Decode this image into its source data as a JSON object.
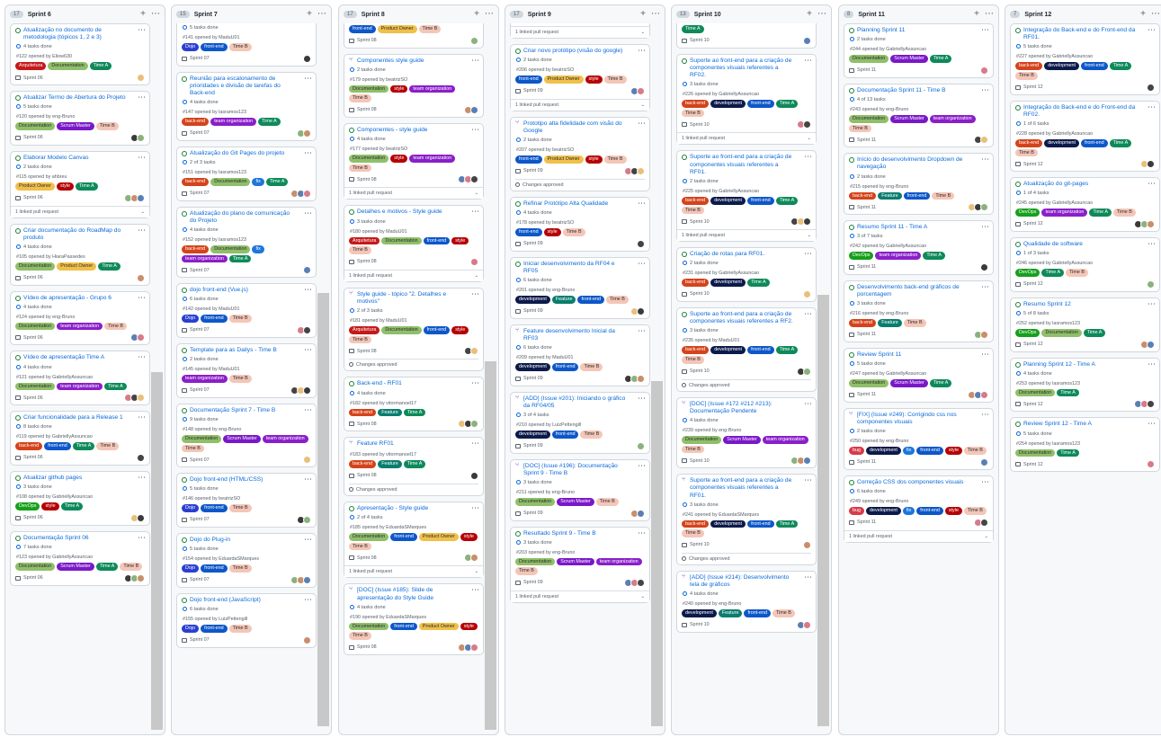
{
  "columns": [
    {
      "title": "Sprint 6",
      "count": "17",
      "cards": [
        {
          "t": "Atualização no documento de metodologia (tópicos 1, 2 e 3)",
          "p": "4 tasks done",
          "m": "#122 opened by Eliow630",
          "l": [
            "Arquitetura",
            "Documentation",
            "Time A"
          ],
          "s": "Sprint 06"
        },
        {
          "t": "Atualizar Termo de Abertura do Projeto",
          "p": "5 tasks done",
          "m": "#120 opened by eng-Bruno",
          "l": [
            "Documentation",
            "Scrum Master",
            "Time B"
          ],
          "s": "Sprint 06"
        },
        {
          "t": "Elaborar Modelo Canvas",
          "p": "2 tasks done",
          "m": "#115 opened by ahbreu",
          "l": [
            "Product Owner",
            "style",
            "Time A"
          ],
          "s": "Sprint 06",
          "pr": "1 linked pull request"
        },
        {
          "t": "Criar documentação do RoadMap do produto",
          "p": "4 tasks done",
          "m": "#105 opened by HiaraPassedes",
          "l": [
            "Documentation",
            "Product Owner",
            "Time A"
          ],
          "s": "Sprint 06"
        },
        {
          "t": "Vídeo de apresentação - Grupo 6",
          "p": "4 tasks done",
          "m": "#124 opened by eng-Bruno",
          "l": [
            "Documentation",
            "team organization",
            "Time B"
          ],
          "s": "Sprint 06"
        },
        {
          "t": "Vídeo de apresentação Time A",
          "p": "4 tasks done",
          "m": "#121 opened by GabriellyAssuncao",
          "l": [
            "Documentation",
            "team organization",
            "Time A"
          ],
          "s": "Sprint 06"
        },
        {
          "t": "Criar funcionalidade para a Release 1",
          "p": "8 tasks done",
          "m": "#119 opened by GabriellyAssuncao",
          "l": [
            "back-end",
            "front-end",
            "Time A",
            "Time B"
          ],
          "s": "Sprint 06"
        },
        {
          "t": "Atualizar github pages",
          "p": "3 tasks done",
          "m": "#108 opened by GabriellyAssuncao",
          "l": [
            "DevOps",
            "style",
            "Time A"
          ],
          "s": "Sprint 06"
        },
        {
          "t": "Documentação Sprint 06",
          "p": "7 tasks done",
          "m": "#123 opened by GabriellyAssuncao",
          "l": [
            "Documentation",
            "Scrum Master",
            "Time A",
            "Time B"
          ],
          "s": "Sprint 06"
        }
      ]
    },
    {
      "title": "Sprint 7",
      "count": "15",
      "cards": [
        {
          "t": "",
          "p": "5 tasks done",
          "m": "#141 opened by MaduU01",
          "l": [
            "Dojo",
            "front-end",
            "Time B"
          ],
          "s": "Sprint 07",
          "cut": true
        },
        {
          "t": "Reunião para escalonamento de prioridades e divisão de tarefas do Back-end",
          "p": "4 tasks done",
          "m": "#147 opened by lasramos123",
          "l": [
            "back-end",
            "team organization",
            "Time A"
          ],
          "s": "Sprint 07"
        },
        {
          "t": "Atualização do Git Pages do projeto",
          "p": "2 of 3 tasks",
          "m": "#151 opened by lasramos123",
          "l": [
            "back-end",
            "Documentation",
            "fix",
            "Time A"
          ],
          "s": "Sprint 07"
        },
        {
          "t": "Atualização do plano de comunicação do Projeto",
          "p": "4 tasks done",
          "m": "#152 opened by lasramos123",
          "l": [
            "back-end",
            "Documentation",
            "fix",
            "team organization",
            "Time A"
          ],
          "s": "Sprint 07"
        },
        {
          "t": "dojo front-end (Vue.js)",
          "p": "6 tasks done",
          "m": "#142 opened by MaduU01",
          "l": [
            "Dojo",
            "front-end",
            "Time B"
          ],
          "s": "Sprint 07"
        },
        {
          "t": "Template para as Dailys - Time B",
          "p": "2 tasks done",
          "m": "#145 opened by MaduU01",
          "l": [
            "team organization",
            "Time B"
          ],
          "s": "Sprint 07"
        },
        {
          "t": "Documentação Sprint 7 - Time B",
          "p": "9 tasks done",
          "m": "#148 opened by eng-Bruno",
          "l": [
            "Documentation",
            "Scrum Master",
            "team organization",
            "Time B"
          ],
          "s": "Sprint 07"
        },
        {
          "t": "Dojo front-end (HTML/CSS)",
          "p": "5 tasks done",
          "m": "#146 opened by beatrizSO",
          "l": [
            "Dojo",
            "front-end",
            "Time B"
          ],
          "s": "Sprint 07"
        },
        {
          "t": "Dojo do Plug-in",
          "p": "5 tasks done",
          "m": "#154 opened by EduardaSMarques",
          "l": [
            "Dojo",
            "front-end",
            "Time B"
          ],
          "s": "Sprint 07"
        },
        {
          "t": "Dojo front-end (JavaScript)",
          "p": "6 tasks done",
          "m": "#155 opened by LuizPettengill",
          "l": [
            "Dojo",
            "front-end",
            "Time B"
          ],
          "s": "Sprint 07"
        }
      ]
    },
    {
      "title": "Sprint 8",
      "count": "17",
      "cards": [
        {
          "t": "",
          "p": "",
          "m": "",
          "l": [
            "front-end",
            "Product Owner",
            "Time B"
          ],
          "s": "Sprint 08",
          "cut": true
        },
        {
          "t": "Componentes style guide",
          "p": "2 tasks done",
          "m": "#179 opened by beatrizSO",
          "l": [
            "Documentation",
            "style",
            "team organization",
            "Time B"
          ],
          "s": "Sprint 08",
          "isPr": true
        },
        {
          "t": "Componentes - style guide",
          "p": "4 tasks done",
          "m": "#177 opened by beatrizSO",
          "l": [
            "Documentation",
            "style",
            "team organization",
            "Time B"
          ],
          "s": "Sprint 08",
          "pr": "1 linked pull request"
        },
        {
          "t": "Detalhes e motivos - Style guide",
          "p": "3 tasks done",
          "m": "#180 opened by MaduU01",
          "l": [
            "Arquitetura",
            "Documentation",
            "front-end",
            "style",
            "Time B"
          ],
          "s": "Sprint 08",
          "pr": "1 linked pull request"
        },
        {
          "t": "Style guide - tópico \"2. Detalhes e motivos\"",
          "p": "2 of 3 tasks",
          "m": "#181 opened by MaduU01",
          "l": [
            "Arquitetura",
            "Documentation",
            "front-end",
            "style",
            "Time B"
          ],
          "s": "Sprint 08",
          "isPr": true,
          "ap": "Changes approved"
        },
        {
          "t": "Back-end - RF01",
          "p": "4 tasks done",
          "m": "#182 opened by vitormanoel17",
          "l": [
            "back-end",
            "Feature",
            "Time A"
          ],
          "s": "Sprint 08"
        },
        {
          "t": "Feature RF01",
          "p": "",
          "m": "#183 opened by vitormanoel17",
          "l": [
            "back-end",
            "Feature",
            "Time A"
          ],
          "s": "Sprint 08",
          "isPr": true,
          "ap": "Changes approved"
        },
        {
          "t": "Apresentação - Style guide",
          "p": "2 of 4 tasks",
          "m": "#185 opened by EduardaSMarques",
          "l": [
            "Documentation",
            "front-end",
            "Product Owner",
            "style",
            "Time B"
          ],
          "s": "Sprint 08",
          "pr": "1 linked pull request"
        },
        {
          "t": "[DOC] (Issue #185): Slide de apresentação do Style Guide",
          "p": "4 tasks done",
          "m": "#190 opened by EduardaSMarques",
          "l": [
            "Documentation",
            "front-end",
            "Product Owner",
            "style",
            "Time B"
          ],
          "s": "Sprint 08",
          "isPr": true
        }
      ]
    },
    {
      "title": "Sprint 9",
      "count": "17",
      "cards": [
        {
          "t": "",
          "p": "",
          "m": "",
          "l": [],
          "s": "",
          "cut": true,
          "pr": "1 linked pull request"
        },
        {
          "t": "Criar novo protótipo (visão do google)",
          "p": "2 tasks done",
          "m": "#206 opened by beatrizSO",
          "l": [
            "front-end",
            "Product Owner",
            "style",
            "Time B"
          ],
          "s": "Sprint 09",
          "pr": "1 linked pull request"
        },
        {
          "t": "Prototipo alta fidelidade com visão do Google",
          "p": "2 tasks done",
          "m": "#207 opened by beatrizSO",
          "l": [
            "front-end",
            "Product Owner",
            "style",
            "Time B"
          ],
          "s": "Sprint 09",
          "isPr": true,
          "ap": "Changes approved"
        },
        {
          "t": "Refinar Protótipo Alta Qualidade",
          "p": "4 tasks done",
          "m": "#178 opened by beatrizSO",
          "l": [
            "front-end",
            "style",
            "Time B"
          ],
          "s": "Sprint 09"
        },
        {
          "t": "Iniciar desenvolvimento da RF04 e RF05",
          "p": "6 tasks done",
          "m": "#201 opened by eng-Bruno",
          "l": [
            "development",
            "Feature",
            "front-end",
            "Time B"
          ],
          "s": "Sprint 09"
        },
        {
          "t": "Feature desenvolvimento Inicial da RF03",
          "p": "6 tasks done",
          "m": "#209 opened by MaduU01",
          "l": [
            "development",
            "front-end",
            "Time B"
          ],
          "s": "Sprint 09",
          "isPr": true
        },
        {
          "t": "[ADD] (Issue #201): Iniciando o gráfico da RF04/05",
          "p": "3 of 4 tasks",
          "m": "#210 opened by LuizPettengill",
          "l": [
            "development",
            "front-end",
            "Time B"
          ],
          "s": "Sprint 09",
          "isPr": true
        },
        {
          "t": "[DOC] (Issue #196): Documentação Sprint 9 - Time B",
          "p": "3 tasks done",
          "m": "#211 opened by eng-Bruno",
          "l": [
            "Documentation",
            "Scrum Master",
            "Time B"
          ],
          "s": "Sprint 09",
          "isPr": true
        },
        {
          "t": "Resultado Sprint 9 - Time B",
          "p": "3 tasks done",
          "m": "#203 opened by eng-Bruno",
          "l": [
            "Documentation",
            "Scrum Master",
            "team organization",
            "Time B"
          ],
          "s": "Sprint 09",
          "pr": "1 linked pull request"
        }
      ]
    },
    {
      "title": "Sprint 10",
      "count": "13",
      "cards": [
        {
          "t": "",
          "p": "",
          "m": "",
          "l": [
            "Time A"
          ],
          "s": "Sprint 10",
          "cut": true
        },
        {
          "t": "Suporte ao front-end para a criação de componentes visuais referentes a RF02.",
          "p": "3 tasks done",
          "m": "#226 opened by GabriellyAssuncao",
          "l": [
            "back-end",
            "development",
            "front-end",
            "Time A",
            "Time B"
          ],
          "s": "Sprint 10",
          "pr": "1 linked pull request"
        },
        {
          "t": "Suporte ao front-end para a criação de componentes visuais referentes a RF01.",
          "p": "2 tasks done",
          "m": "#225 opened by GabriellyAssuncao",
          "l": [
            "back-end",
            "development",
            "front-end",
            "Time A",
            "Time B"
          ],
          "s": "Sprint 10",
          "pr": "1 linked pull request"
        },
        {
          "t": "Criação de rotas para RF01.",
          "p": "2 tasks done",
          "m": "#231 opened by GabriellyAssuncao",
          "l": [
            "back-end",
            "development",
            "Time A"
          ],
          "s": "Sprint 10"
        },
        {
          "t": "Suporte ao front-end para a criação de componentes visuais referentes a RF2.",
          "p": "3 tasks done",
          "m": "#235 opened by MaduU01",
          "l": [
            "back-end",
            "development",
            "front-end",
            "Time A",
            "Time B"
          ],
          "s": "Sprint 10",
          "ap": "Changes approved"
        },
        {
          "t": "[DOC] (Issue #172 #212 #213): Documentação Pendente",
          "p": "4 tasks done",
          "m": "#239 opened by eng-Bruno",
          "l": [
            "Documentation",
            "Scrum Master",
            "team organization",
            "Time B"
          ],
          "s": "Sprint 10",
          "isPr": true
        },
        {
          "t": "Suporte ao front-end para a criação de componentes visuais referentes a RF01.",
          "p": "3 tasks done",
          "m": "#241 opened by EduardaSMarques",
          "l": [
            "back-end",
            "development",
            "front-end",
            "Time A",
            "Time B"
          ],
          "s": "Sprint 10",
          "isPr": true,
          "ap": "Changes approved"
        },
        {
          "t": "[ADD] (Issue #214): Desenvolvimento tela de gráficos",
          "p": "4 tasks done",
          "m": "#240 opened by eng-Bruno",
          "l": [
            "development",
            "Feature",
            "front-end",
            "Time B"
          ],
          "s": "Sprint 10",
          "isPr": true
        }
      ]
    },
    {
      "title": "Sprint 11",
      "count": "8",
      "cards": [
        {
          "t": "Planning Sprint 11",
          "p": "2 tasks done",
          "m": "#244 opened by GabriellyAssuncao",
          "l": [
            "Documentation",
            "Scrum Master",
            "Time A"
          ],
          "s": "Sprint 11"
        },
        {
          "t": "Documentação Sprint 11 - Time B",
          "p": "4 of 13 tasks",
          "m": "#243 opened by eng-Bruno",
          "l": [
            "Documentation",
            "Scrum Master",
            "team organization",
            "Time B"
          ],
          "s": "Sprint 11"
        },
        {
          "t": "Início do desenvolvimento Dropdown de navegação",
          "p": "2 tasks done",
          "m": "#215 opened by eng-Bruno",
          "l": [
            "back-end",
            "Feature",
            "front-end",
            "Time B"
          ],
          "s": "Sprint 11"
        },
        {
          "t": "Resumo Sprint 11 - Time A",
          "p": "3 of 7 tasks",
          "m": "#242 opened by GabriellyAssuncao",
          "l": [
            "DevOps",
            "team organization",
            "Time A"
          ],
          "s": "Sprint 11"
        },
        {
          "t": "Desenvolvimento back-end gráficos de porcentagem",
          "p": "3 tasks done",
          "m": "#216 opened by eng-Bruno",
          "l": [
            "back-end",
            "Feature",
            "Time B"
          ],
          "s": "Sprint 11"
        },
        {
          "t": "Review Sprint 11",
          "p": "5 tasks done",
          "m": "#247 opened by GabriellyAssuncao",
          "l": [
            "Documentation",
            "Scrum Master",
            "Time A"
          ],
          "s": "Sprint 11"
        },
        {
          "t": "[FIX] (Issue #249): Corrigindo css nos componentes visuais",
          "p": "2 tasks done",
          "m": "#250 opened by eng-Bruno",
          "l": [
            "bug",
            "development",
            "fix",
            "front-end",
            "style",
            "Time B"
          ],
          "s": "Sprint 11",
          "isPr": true
        },
        {
          "t": "Correção CSS dos componentes visuais",
          "p": "6 tasks done",
          "m": "#249 opened by eng-Bruno",
          "l": [
            "bug",
            "development",
            "fix",
            "front-end",
            "style",
            "Time B"
          ],
          "s": "Sprint 11",
          "pr": "1 linked pull request"
        }
      ]
    },
    {
      "title": "Sprint 12",
      "count": "7",
      "cards": [
        {
          "t": "Integração do Back-end e do Front-end da RF01.",
          "p": "5 tasks done",
          "m": "#227 opened by GabriellyAssuncao",
          "l": [
            "back-end",
            "development",
            "front-end",
            "Time A",
            "Time B"
          ],
          "s": "Sprint 12"
        },
        {
          "t": "Integração do Back-end e do Front-end da RF02.",
          "p": "1 of 6 tasks",
          "m": "#228 opened by GabriellyAssuncao",
          "l": [
            "back-end",
            "development",
            "front-end",
            "Time A",
            "Time B"
          ],
          "s": "Sprint 12"
        },
        {
          "t": "Atualização do git-pages",
          "p": "1 of 4 tasks",
          "m": "#245 opened by GabriellyAssuncao",
          "l": [
            "DevOps",
            "team organization",
            "Time A",
            "Time B"
          ],
          "s": "Sprint 12"
        },
        {
          "t": "Qualidade de software",
          "p": "1 of 3 tasks",
          "m": "#246 opened by GabriellyAssuncao",
          "l": [
            "DevOps",
            "Time A",
            "Time B"
          ],
          "s": "Sprint 12"
        },
        {
          "t": "Resumo Sprint 12",
          "p": "5 of 8 tasks",
          "m": "#252 opened by lasramos123",
          "l": [
            "DevOps",
            "Documentation",
            "Time A"
          ],
          "s": "Sprint 12"
        },
        {
          "t": "Planning Sprint 12 - Time A",
          "p": "4 tasks done",
          "m": "#253 opened by lasramos123",
          "l": [
            "Documentation",
            "Time A"
          ],
          "s": "Sprint 12"
        },
        {
          "t": "Review Sprint 12 - Time A",
          "p": "5 tasks done",
          "m": "#254 opened by lasramos123",
          "l": [
            "Documentation",
            "Time A"
          ],
          "s": "Sprint 12"
        }
      ]
    }
  ],
  "label_colors": {
    "Arquitetura": "#c51a1a",
    "Documentation": "#8fbf6a",
    "Time A": "#0e8a5a",
    "Time B": "#f4c6b8",
    "Scrum Master": "#7a18c8",
    "Product Owner": "#f0c04a",
    "style": "#b60205",
    "team organization": "#8a1fc9",
    "back-end": "#d4431b",
    "front-end": "#0d57c9",
    "DevOps": "#16a01c",
    "fix": "#1d76db",
    "Dojo": "#2a3fd0",
    "Feature": "#0b7d6e",
    "development": "#0b1a4a",
    "bug": "#d73a4a"
  },
  "dark_text_labels": [
    "Documentation",
    "Time B",
    "Product Owner"
  ],
  "icons": {
    "add": "plus-icon",
    "more": "kebab-icon",
    "sprint": "iteration-icon",
    "issue": "open-issue-icon",
    "pull_request": "pull-request-icon"
  }
}
